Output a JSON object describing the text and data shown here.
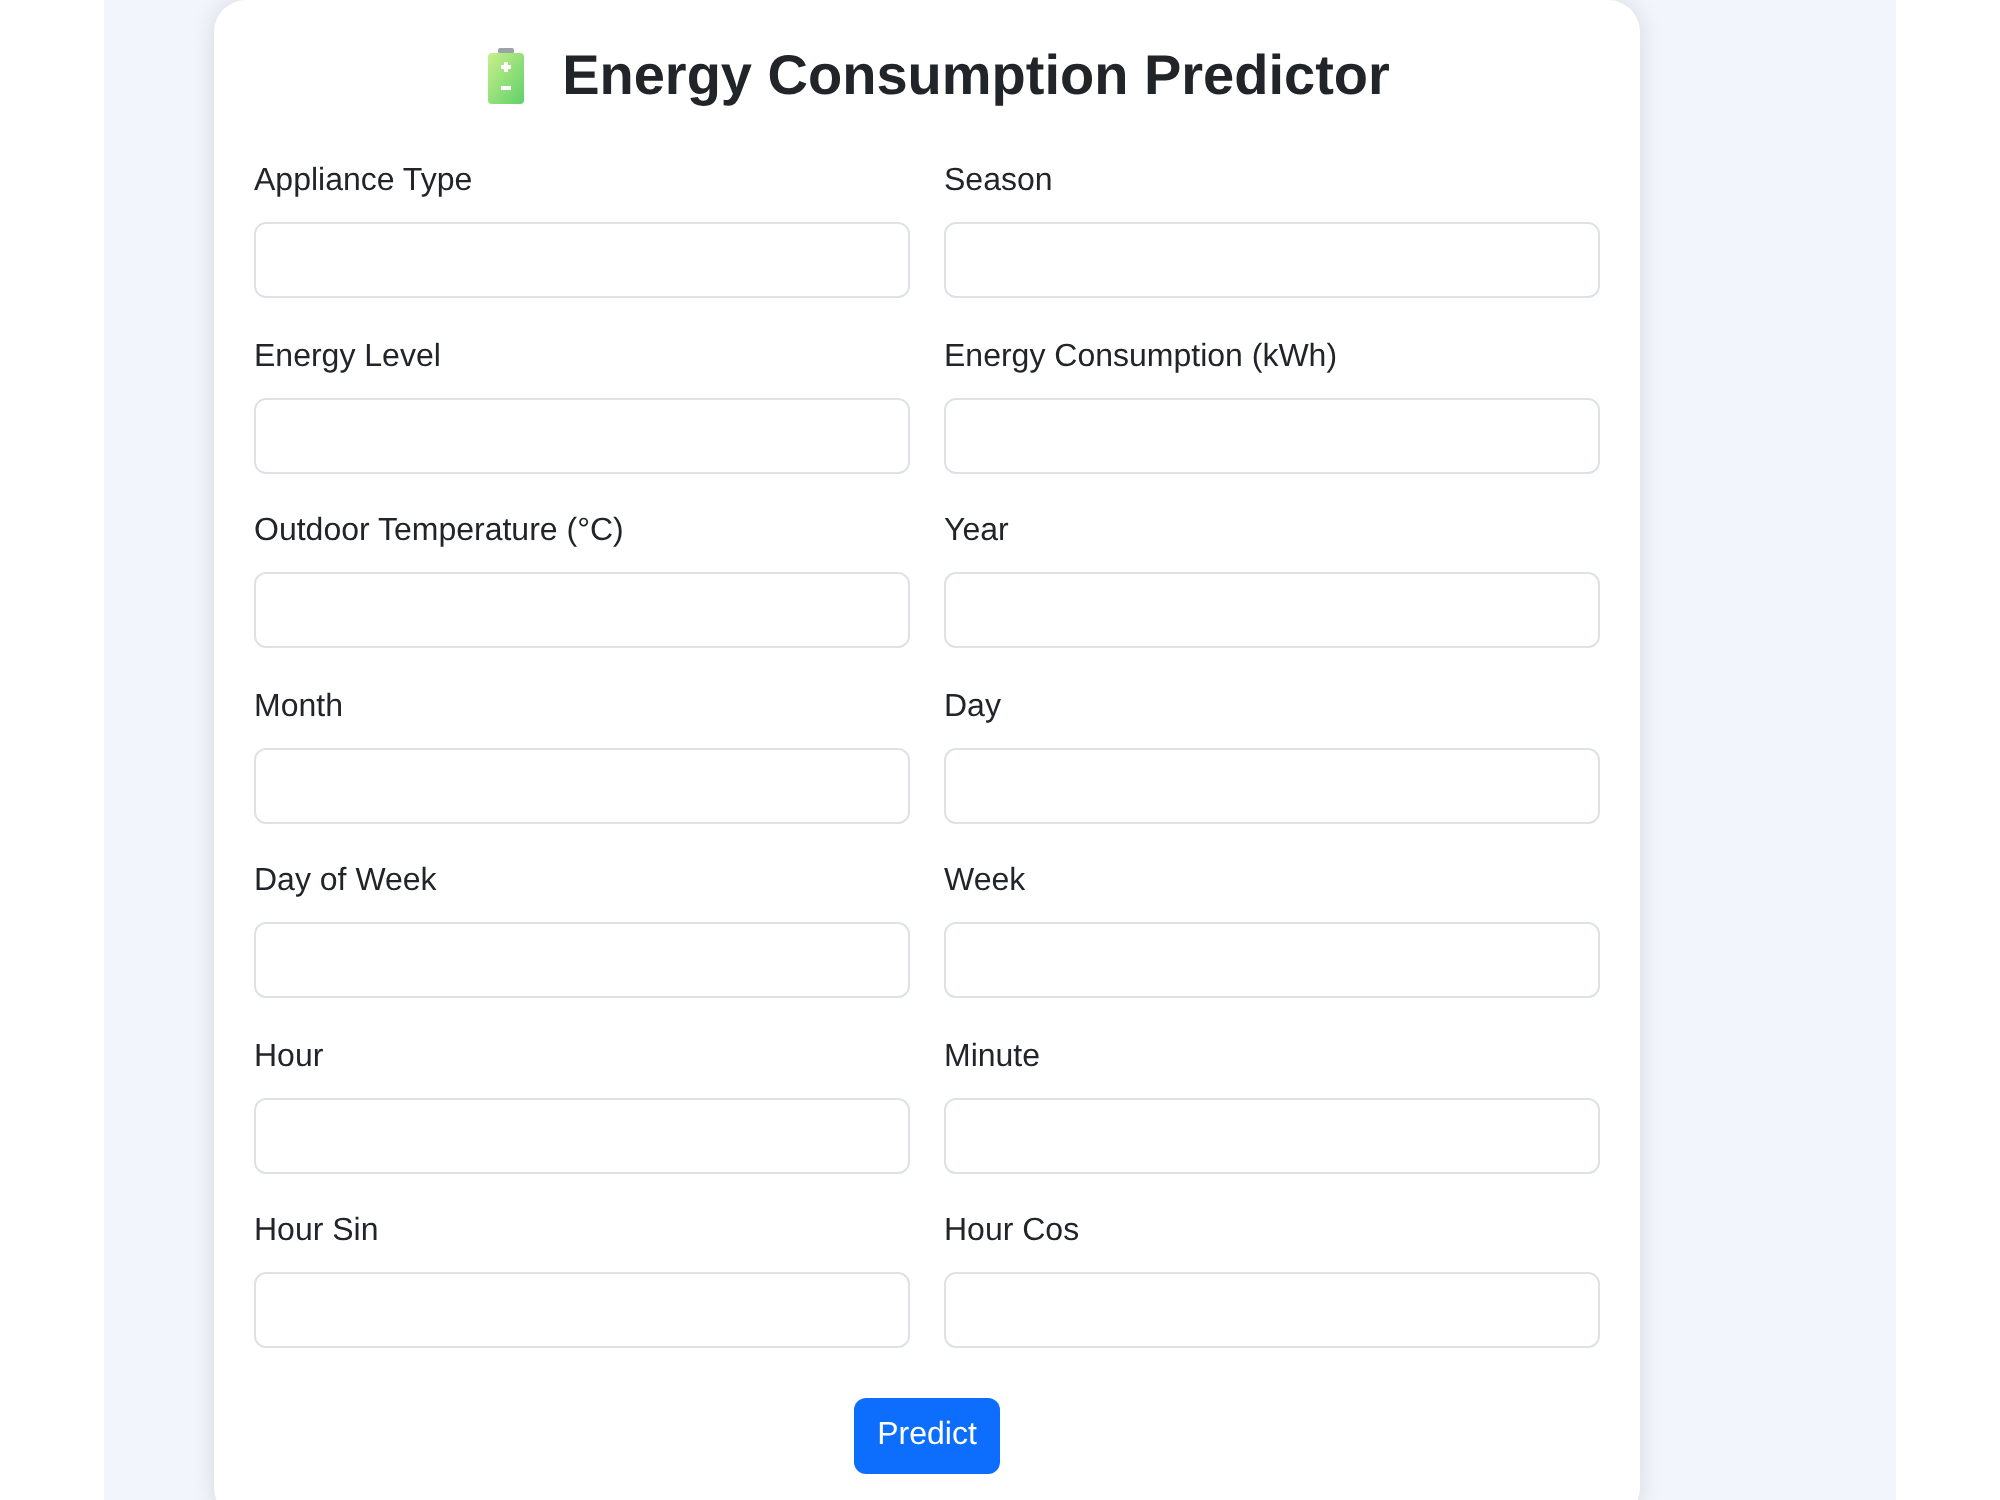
{
  "title": "Energy Consumption Predictor",
  "fields": [
    {
      "label": "Appliance Type"
    },
    {
      "label": "Season"
    },
    {
      "label": "Energy Level"
    },
    {
      "label": "Energy Consumption (kWh)"
    },
    {
      "label": "Outdoor Temperature (°C)"
    },
    {
      "label": "Year"
    },
    {
      "label": "Month"
    },
    {
      "label": "Day"
    },
    {
      "label": "Day of Week"
    },
    {
      "label": "Week"
    },
    {
      "label": "Hour"
    },
    {
      "label": "Minute"
    },
    {
      "label": "Hour Sin"
    },
    {
      "label": "Hour Cos"
    }
  ],
  "button": {
    "label": "Predict"
  }
}
